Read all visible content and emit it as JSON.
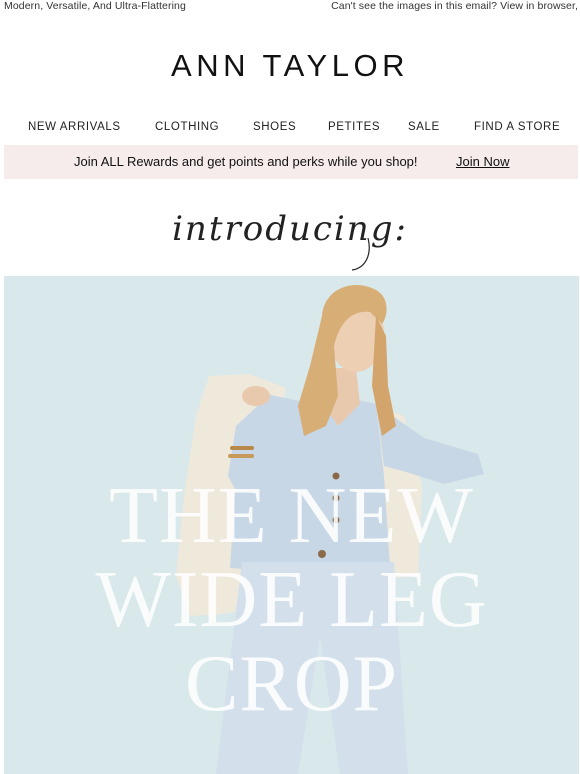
{
  "preheader": {
    "tagline": "Modern, Versatile, And Ultra-Flattering",
    "view_in_browser": "Can't see the images in this email? View in browser,"
  },
  "brand": {
    "logo": "ANN TAYLOR"
  },
  "nav": {
    "items": [
      {
        "label": "NEW ARRIVALS"
      },
      {
        "label": "CLOTHING"
      },
      {
        "label": "SHOES"
      },
      {
        "label": "PETITES"
      },
      {
        "label": "SALE"
      },
      {
        "label": "FIND A STORE"
      }
    ]
  },
  "rewards": {
    "message": "Join ALL Rewards and get points and perks while you shop!",
    "cta": "Join Now",
    "background": "#f6eceb"
  },
  "intro": {
    "script_text": "introducing:"
  },
  "hero": {
    "title_lines": [
      "THE NEW",
      "WIDE LEG",
      "CROP"
    ],
    "background": "#d9e8ea"
  }
}
